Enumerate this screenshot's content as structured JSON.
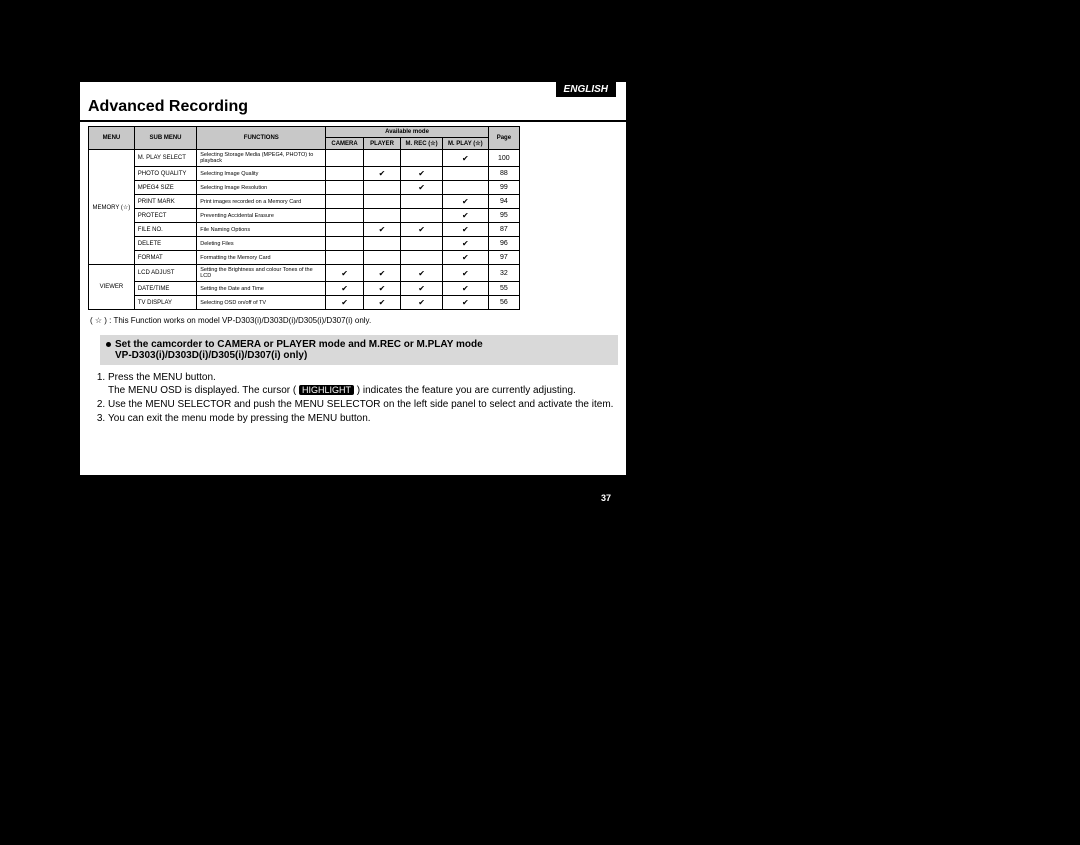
{
  "language_badge": "ENGLISH",
  "title": "Advanced Recording",
  "table": {
    "headers": {
      "menu": "MENU",
      "sub_menu": "SUB MENU",
      "functions": "FUNCTIONS",
      "available_mode": "Available mode",
      "camera": "CAMERA",
      "player": "PLAYER",
      "mrec": "M. REC (☆)",
      "mplay": "M. PLAY (☆)",
      "page": "Page"
    },
    "groups": [
      {
        "menu": "MEMORY (☆)",
        "rows": [
          {
            "sub": "M. PLAY SELECT",
            "func": "Selecting Storage Media (MPEG4, PHOTO) to playback",
            "camera": "",
            "player": "",
            "mrec": "",
            "mplay": "✔",
            "page": "100"
          },
          {
            "sub": "PHOTO QUALITY",
            "func": "Selecting Image Quality",
            "camera": "",
            "player": "✔",
            "mrec": "✔",
            "mplay": "",
            "page": "88"
          },
          {
            "sub": "MPEG4 SIZE",
            "func": "Selecting Image Resolution",
            "camera": "",
            "player": "",
            "mrec": "✔",
            "mplay": "",
            "page": "99"
          },
          {
            "sub": "PRINT MARK",
            "func": "Print images recorded on a Memory Card",
            "camera": "",
            "player": "",
            "mrec": "",
            "mplay": "✔",
            "page": "94"
          },
          {
            "sub": "PROTECT",
            "func": "Preventing Accidental Erasure",
            "camera": "",
            "player": "",
            "mrec": "",
            "mplay": "✔",
            "page": "95"
          },
          {
            "sub": "FILE NO.",
            "func": "File Naming Options",
            "camera": "",
            "player": "✔",
            "mrec": "✔",
            "mplay": "✔",
            "page": "87"
          },
          {
            "sub": "DELETE",
            "func": "Deleting Files",
            "camera": "",
            "player": "",
            "mrec": "",
            "mplay": "✔",
            "page": "96"
          },
          {
            "sub": "FORMAT",
            "func": "Formatting the Memory Card",
            "camera": "",
            "player": "",
            "mrec": "",
            "mplay": "✔",
            "page": "97"
          }
        ]
      },
      {
        "menu": "VIEWER",
        "rows": [
          {
            "sub": "LCD ADJUST",
            "func": "Setting the Brightness and colour Tones of the LCD",
            "camera": "✔",
            "player": "✔",
            "mrec": "✔",
            "mplay": "✔",
            "page": "32"
          },
          {
            "sub": "DATE/TIME",
            "func": "Setting the Date and Time",
            "camera": "✔",
            "player": "✔",
            "mrec": "✔",
            "mplay": "✔",
            "page": "55"
          },
          {
            "sub": "TV DISPLAY",
            "func": "Selecting OSD on/off of TV",
            "camera": "✔",
            "player": "✔",
            "mrec": "✔",
            "mplay": "✔",
            "page": "56"
          }
        ]
      }
    ]
  },
  "footnote": "( ☆ ) : This Function works on model VP-D303(i)/D303D(i)/D305(i)/D307(i) only.",
  "instruction": {
    "line1": "Set the camcorder to CAMERA or PLAYER mode and M.REC or M.PLAY mode",
    "line2": "VP-D303(i)/D303D(i)/D305(i)/D307(i) only)"
  },
  "steps": {
    "s1a": "Press the MENU button.",
    "s1b_pre": "The MENU OSD is displayed. The cursor ( ",
    "s1b_highlight": "HIGHLIGHT",
    "s1b_post": " ) indicates the feature you are currently adjusting.",
    "s2": "Use the MENU SELECTOR and push the MENU SELECTOR on the left side panel to select and activate the item.",
    "s3": "You can exit the menu mode by pressing the MENU button."
  },
  "page_number": "37"
}
